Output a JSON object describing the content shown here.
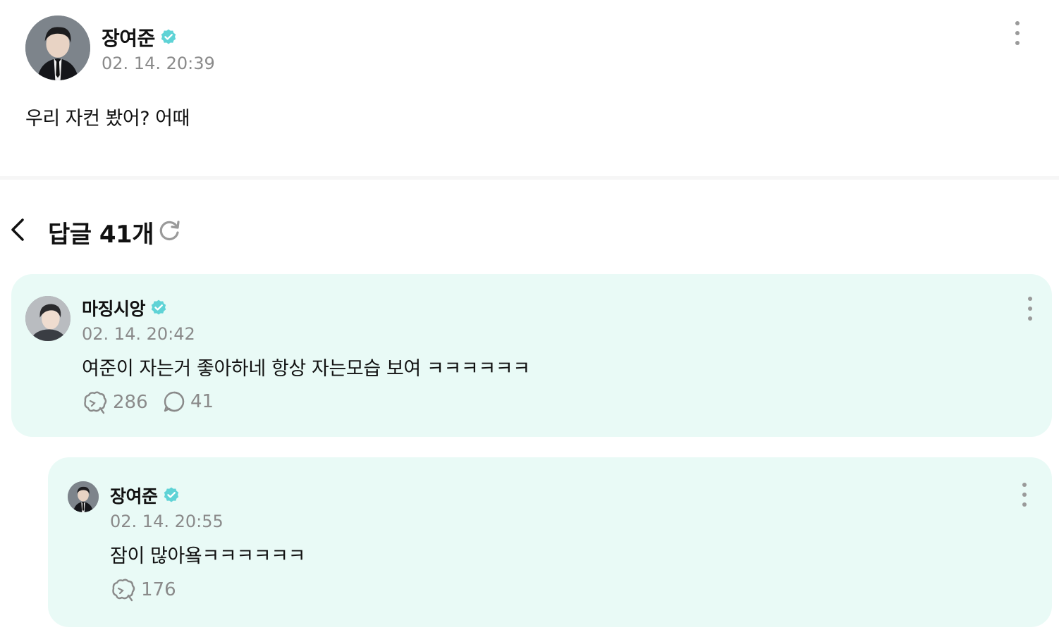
{
  "post": {
    "author": "장여준",
    "time": "02. 14. 20:39",
    "text": "우리 자컨 봤어? 어때",
    "avatar_icon": "profile-photo",
    "verified_icon": "verified-badge-icon",
    "more_icon": "more-vertical-icon"
  },
  "replies": {
    "title": "답글 41개",
    "back_icon": "chevron-left-icon",
    "refresh_icon": "refresh-icon"
  },
  "comments": [
    {
      "author": "마징시앙",
      "time": "02. 14. 20:42",
      "text": "여준이 자는거 좋아하네 항상 자는모습 보여 ㅋㅋㅋㅋㅋㅋ",
      "likes": "286",
      "replies": "41"
    },
    {
      "author": "장여준",
      "time": "02. 14. 20:55",
      "text": "잠이 많아욬ㅋㅋㅋㅋㅋㅋ",
      "likes": "176"
    }
  ],
  "colors": {
    "verified": "#5fd3d6",
    "card_bg": "#e9faf6",
    "muted": "#8a8a8a"
  }
}
